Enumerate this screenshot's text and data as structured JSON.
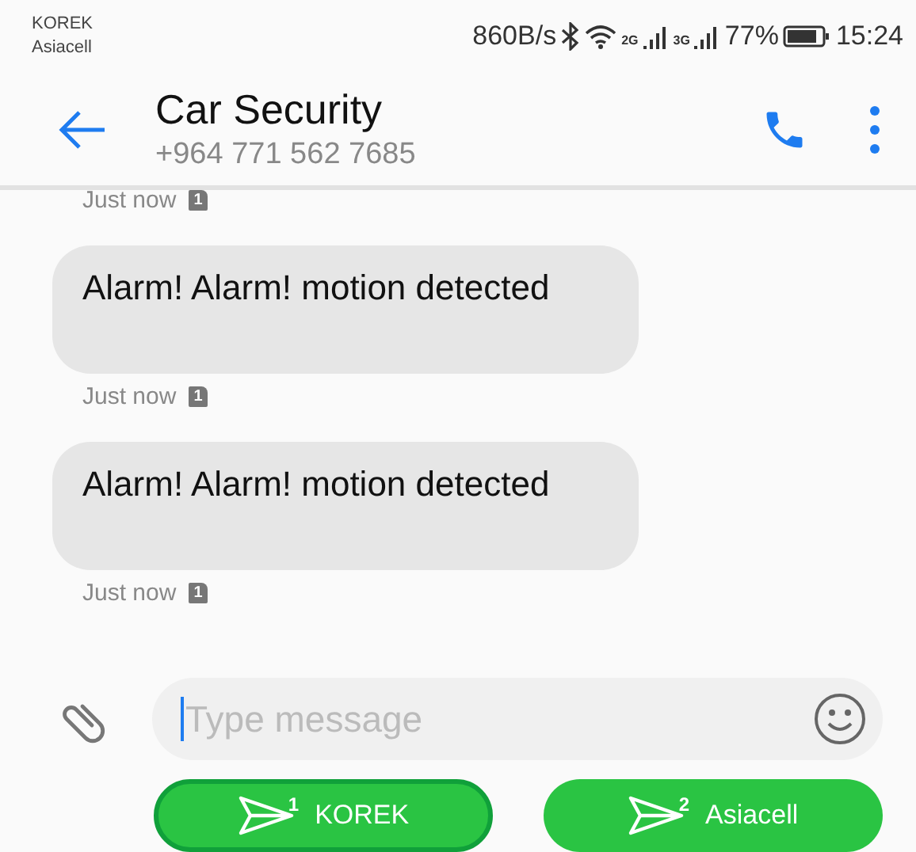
{
  "status_bar": {
    "carriers": [
      "KOREK",
      "Asiacell"
    ],
    "speed": "860B/s",
    "networks": [
      "2G",
      "3G"
    ],
    "battery": "77%",
    "time": "15:24"
  },
  "header": {
    "title": "Car Security",
    "subtitle": "+964 771 562 7685"
  },
  "messages": [
    {
      "kind": "meta",
      "time": "Just now",
      "sim": "1"
    },
    {
      "kind": "bubble",
      "text": "Alarm! Alarm! motion detected"
    },
    {
      "kind": "meta",
      "time": "Just now",
      "sim": "1"
    },
    {
      "kind": "bubble",
      "text": "Alarm! Alarm! motion detected"
    },
    {
      "kind": "meta",
      "time": "Just now",
      "sim": "1"
    }
  ],
  "composer": {
    "placeholder": "Type message"
  },
  "send_buttons": [
    {
      "sim": "1",
      "label": "KOREK",
      "selected": true
    },
    {
      "sim": "2",
      "label": "Asiacell",
      "selected": false
    }
  ]
}
